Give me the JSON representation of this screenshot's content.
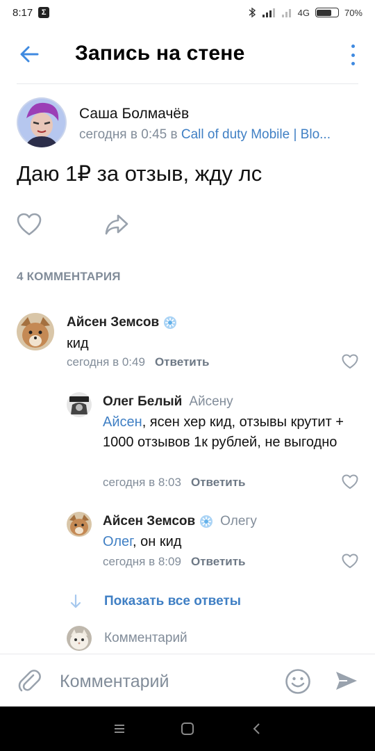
{
  "status_bar": {
    "time": "8:17",
    "app_badge": "Σ",
    "network": "4G",
    "battery": "70%",
    "battery_level": 0.7
  },
  "header": {
    "title": "Запись на стене",
    "back_icon": "arrow-left-icon",
    "more_icon": "more-vertical-icon",
    "accent_color": "#3f8ae0"
  },
  "post": {
    "author": "Саша Болмачёв",
    "time_prefix": "сегодня в 0:45 в ",
    "group": "Call of duty Mobile | Blo...",
    "text": "Даю 1₽ за отзыв, жду лс"
  },
  "comments_count": "4 КОММЕНТАРИЯ",
  "comments": [
    {
      "author": "Айсен Земсов",
      "verified": true,
      "text": "кид",
      "time": "сегодня в 0:49",
      "reply_label": "Ответить"
    },
    {
      "author": "Олег Белый",
      "reply_to": "Айсену",
      "mention": "Айсен",
      "text": ", ясен хер кид, отзывы крутит + 1000 отзывов 1к рублей, не выгодно",
      "time": "сегодня в 8:03",
      "reply_label": "Ответить"
    },
    {
      "author": "Айсен Земсов",
      "verified": true,
      "reply_to": "Олегу",
      "mention": "Олег",
      "text": ", он кид",
      "time": "сегодня в 8:09",
      "reply_label": "Ответить"
    }
  ],
  "show_all_replies": "Показать все ответы",
  "reply_placeholder": "Комментарий",
  "input_bar": {
    "placeholder": "Комментарий"
  }
}
